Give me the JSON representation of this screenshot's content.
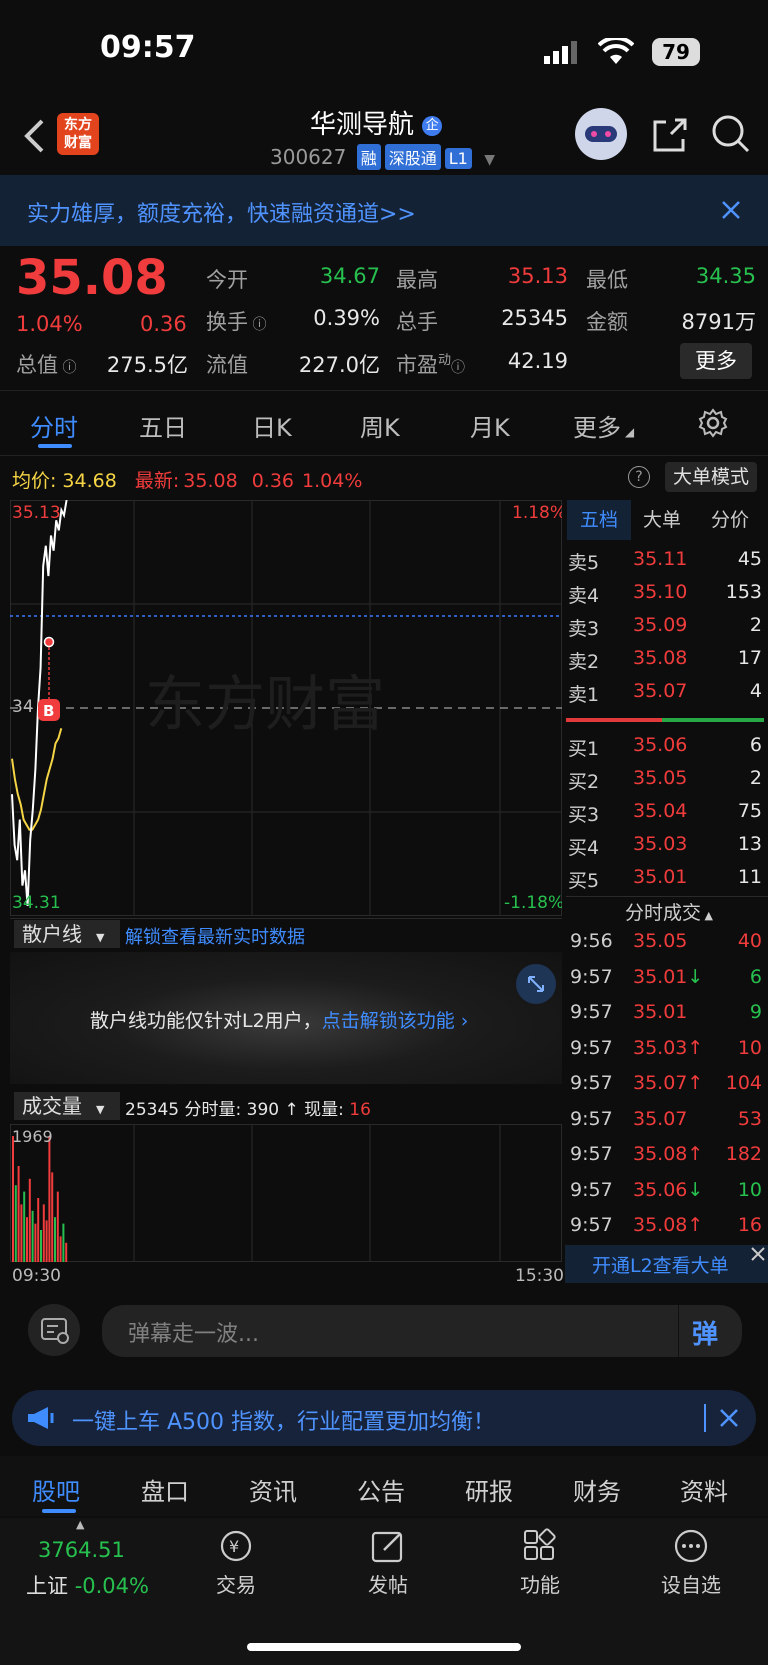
{
  "status_bar": {
    "time": "09:57",
    "battery": "79"
  },
  "header": {
    "logo_line1": "东方",
    "logo_line2": "财富",
    "stock_name": "华测导航",
    "name_badge": "企",
    "code": "300627",
    "tags": [
      "融",
      "深股通",
      "L1"
    ]
  },
  "banner": {
    "text": "实力雄厚，额度充裕，快速融资通道>>"
  },
  "quote": {
    "price": "35.08",
    "change_pct": "1.04%",
    "change": "0.36",
    "stats": [
      {
        "label": "今开",
        "value": "34.67",
        "color": "green"
      },
      {
        "label": "最高",
        "value": "35.13",
        "color": "red"
      },
      {
        "label": "最低",
        "value": "34.35",
        "color": "green"
      },
      {
        "label": "换手",
        "value": "0.39%",
        "color": "white"
      },
      {
        "label": "总手",
        "value": "25345",
        "color": "white"
      },
      {
        "label": "金额",
        "value": "8791万",
        "color": "white"
      },
      {
        "label": "总值",
        "value": "275.5亿",
        "color": "white"
      },
      {
        "label": "流值",
        "value": "227.0亿",
        "color": "white"
      },
      {
        "label": "市盈",
        "label_sup": "动",
        "value": "42.19",
        "color": "white"
      }
    ],
    "more_button": "更多"
  },
  "tabs": [
    "分时",
    "五日",
    "日K",
    "周K",
    "月K",
    "更多"
  ],
  "chart_info": {
    "avg_label": "均价:",
    "avg_value": "34.68",
    "latest_label": "最新:",
    "latest_price": "35.08",
    "latest_change": "0.36",
    "latest_pct": "1.04%",
    "mode_button": "大单模式"
  },
  "chart_data": {
    "type": "line",
    "price_high_label": "35.13",
    "price_low_label": "34.31",
    "price_mid_label": "34",
    "pct_high_label": "1.18%",
    "pct_low_label": "-1.18%",
    "ylim": [
      34.31,
      35.13
    ],
    "series": [
      {
        "name": "",
        "values": [
          34.55,
          34.45,
          34.42,
          34.5,
          34.37,
          34.4,
          34.33,
          34.46,
          34.52,
          34.6,
          34.72,
          34.8,
          35.0,
          35.04,
          34.98,
          35.06,
          35.03,
          35.09,
          35.07,
          35.11,
          35.1,
          35.13
        ]
      },
      {
        "name": "",
        "values": [
          34.62,
          34.58,
          34.55,
          34.53,
          34.5,
          34.49,
          34.48,
          34.48,
          34.49,
          34.5,
          34.52,
          34.55,
          34.58,
          34.6,
          34.62,
          34.65,
          34.66,
          34.68
        ]
      }
    ],
    "marker_b": "B",
    "volume_max_label": "1969",
    "time_start": "09:30",
    "time_end": "15:30",
    "volume": [
      {
        "v": 1969,
        "up": true
      },
      {
        "v": 1200,
        "up": false
      },
      {
        "v": 1500,
        "up": true
      },
      {
        "v": 900,
        "up": true
      },
      {
        "v": 1100,
        "up": false
      },
      {
        "v": 700,
        "up": true
      },
      {
        "v": 1300,
        "up": true
      },
      {
        "v": 800,
        "up": false
      },
      {
        "v": 600,
        "up": true
      },
      {
        "v": 1000,
        "up": true
      },
      {
        "v": 500,
        "up": false
      },
      {
        "v": 900,
        "up": true
      },
      {
        "v": 650,
        "up": true
      },
      {
        "v": 1969,
        "up": true
      },
      {
        "v": 1400,
        "up": true
      },
      {
        "v": 700,
        "up": false
      },
      {
        "v": 1100,
        "up": true
      },
      {
        "v": 400,
        "up": true
      },
      {
        "v": 600,
        "up": false
      },
      {
        "v": 300,
        "up": true
      }
    ]
  },
  "order_book": {
    "tabs": [
      "五档",
      "大单",
      "分价"
    ],
    "asks": [
      {
        "label": "卖5",
        "price": "35.11",
        "vol": "45"
      },
      {
        "label": "卖4",
        "price": "35.10",
        "vol": "153"
      },
      {
        "label": "卖3",
        "price": "35.09",
        "vol": "2"
      },
      {
        "label": "卖2",
        "price": "35.08",
        "vol": "17"
      },
      {
        "label": "卖1",
        "price": "35.07",
        "vol": "4"
      }
    ],
    "bids": [
      {
        "label": "买1",
        "price": "35.06",
        "vol": "6"
      },
      {
        "label": "买2",
        "price": "35.05",
        "vol": "2"
      },
      {
        "label": "买3",
        "price": "35.04",
        "vol": "75"
      },
      {
        "label": "买4",
        "price": "35.03",
        "vol": "13"
      },
      {
        "label": "买5",
        "price": "35.01",
        "vol": "11"
      }
    ],
    "trades_title": "分时成交",
    "trades": [
      {
        "time": "9:56",
        "price": "35.05",
        "arrow": "",
        "vol": "40",
        "vol_color": "red"
      },
      {
        "time": "9:57",
        "price": "35.01",
        "arrow": "↓",
        "vol": "6",
        "vol_color": "green"
      },
      {
        "time": "9:57",
        "price": "35.01",
        "arrow": "",
        "vol": "9",
        "vol_color": "green"
      },
      {
        "time": "9:57",
        "price": "35.03",
        "arrow": "↑",
        "vol": "10",
        "vol_color": "red"
      },
      {
        "time": "9:57",
        "price": "35.07",
        "arrow": "↑",
        "vol": "104",
        "vol_color": "red"
      },
      {
        "time": "9:57",
        "price": "35.07",
        "arrow": "",
        "vol": "53",
        "vol_color": "red"
      },
      {
        "time": "9:57",
        "price": "35.08",
        "arrow": "↑",
        "vol": "182",
        "vol_color": "red"
      },
      {
        "time": "9:57",
        "price": "35.06",
        "arrow": "↓",
        "vol": "10",
        "vol_color": "green"
      },
      {
        "time": "9:57",
        "price": "35.08",
        "arrow": "↑",
        "vol": "16",
        "vol_color": "red"
      }
    ],
    "l2_link": "开通L2查看大单"
  },
  "retail_line": {
    "selector": "散户线",
    "unlock_link": "解锁查看最新实时数据",
    "notice": "散户线功能仅针对L2用户，",
    "notice_link": "点击解锁该功能"
  },
  "volume_bar": {
    "selector": "成交量",
    "total": "25345",
    "label_fenshi": "分时量:",
    "fenshi_value": "390",
    "label_now": "现量:",
    "now_value": "16"
  },
  "danmaku": {
    "placeholder": "弹幕走一波...",
    "send": "弹"
  },
  "promo": {
    "text": "一键上车 A500 指数，行业配置更加均衡！"
  },
  "subtabs": [
    "股吧",
    "盘口",
    "资讯",
    "公告",
    "研报",
    "财务",
    "资料"
  ],
  "bottom_nav": {
    "index_value": "3764.51",
    "index_name": "上证",
    "index_change": "-0.04%",
    "items": [
      "交易",
      "发帖",
      "功能",
      "设自选"
    ]
  },
  "watermark": "东方财富"
}
